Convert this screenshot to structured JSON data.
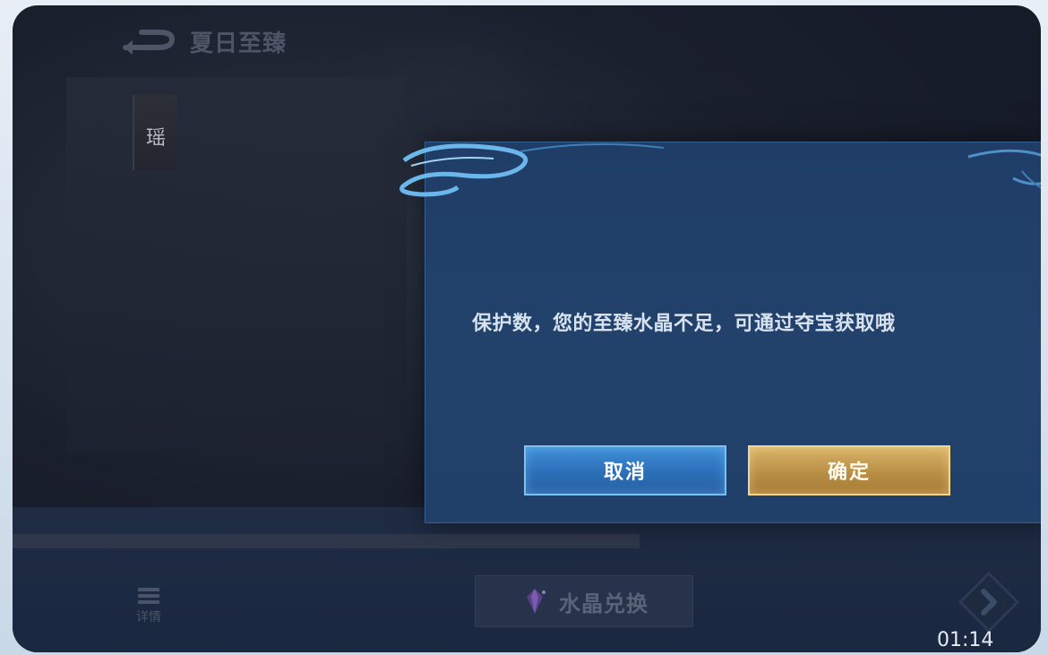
{
  "header": {
    "title": "夏日至臻",
    "back_icon": "back-arrow-icon"
  },
  "side_tab": {
    "label": "瑶"
  },
  "dialog": {
    "message": "保护数，您的至臻水晶不足，可通过夺宝获取哦",
    "cancel_label": "取消",
    "confirm_label": "确定"
  },
  "bottom_bar": {
    "details_label": "详情",
    "details_icon": "list-icon",
    "exchange_label": "水晶兑换",
    "exchange_icon": "crystal-icon",
    "next_icon": "next-diamond-icon"
  },
  "status": {
    "clock": "01:14"
  },
  "colors": {
    "dialog_bg": "#1f3d67",
    "cancel_button": "#2b6fb8",
    "confirm_button": "#b98f45",
    "message_text": "#d8e2ef"
  }
}
